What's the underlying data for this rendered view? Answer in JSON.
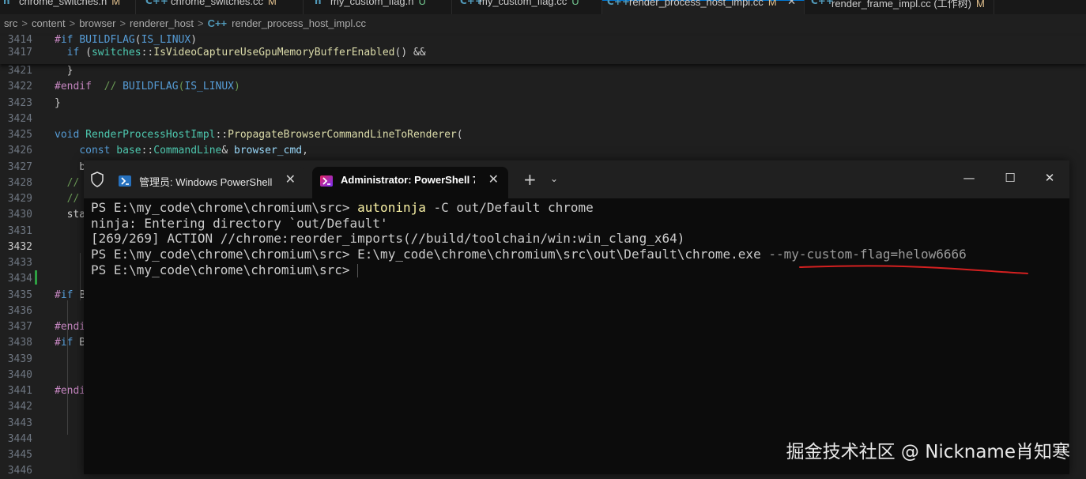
{
  "editor_tabs": [
    {
      "label": "chrome_switches.h",
      "status": "M",
      "icon": "header-file-icon",
      "icon_glyph": "h"
    },
    {
      "label": "chrome_switches.cc",
      "status": "M",
      "icon": "cpp-file-icon",
      "icon_glyph": "C++"
    },
    {
      "label": "my_custom_flag.h",
      "status": "U",
      "icon": "header-file-icon",
      "icon_glyph": "h"
    },
    {
      "label": "my_custom_flag.cc",
      "status": "U",
      "icon": "cpp-file-icon",
      "icon_glyph": "C++"
    },
    {
      "label": "render_process_host_impl.cc",
      "status": "M",
      "icon": "cpp-file-icon",
      "icon_glyph": "C++",
      "active": true,
      "close": "✕"
    },
    {
      "label": "render_frame_impl.cc (工作树)",
      "status": "M",
      "icon": "cpp-file-icon",
      "icon_glyph": "C++"
    }
  ],
  "breadcrumb": {
    "parts": [
      "src",
      "content",
      "browser",
      "renderer_host"
    ],
    "file": "render_process_host_impl.cc",
    "separator": ">",
    "file_icon": "C++"
  },
  "code_lines": [
    {
      "n": "3414",
      "text": "#if BUILDFLAG(IS_LINUX)"
    },
    {
      "n": "3417",
      "text": "  if (switches::IsVideoCaptureUseGpuMemoryBufferEnabled() &&"
    },
    {
      "n": "3421",
      "text": "  }"
    },
    {
      "n": "3422",
      "text": "#endif  // BUILDFLAG(IS_LINUX)"
    },
    {
      "n": "3423",
      "text": "}"
    },
    {
      "n": "3424",
      "text": ""
    },
    {
      "n": "3425",
      "text": "void RenderProcessHostImpl::PropagateBrowserCommandLineToRenderer("
    },
    {
      "n": "3426",
      "text": "    const base::CommandLine& browser_cmd,"
    },
    {
      "n": "3427",
      "text": "    b"
    },
    {
      "n": "3428",
      "text": "  //"
    },
    {
      "n": "3429",
      "text": "  //"
    },
    {
      "n": "3430",
      "text": "  sta"
    },
    {
      "n": "3431",
      "text": ""
    },
    {
      "n": "3432",
      "text": ""
    },
    {
      "n": "3433",
      "text": ""
    },
    {
      "n": "3434",
      "text": ""
    },
    {
      "n": "3435",
      "text": "#if B"
    },
    {
      "n": "3436",
      "text": ""
    },
    {
      "n": "3437",
      "text": "#endi"
    },
    {
      "n": "3438",
      "text": "#if B"
    },
    {
      "n": "3439",
      "text": ""
    },
    {
      "n": "3440",
      "text": ""
    },
    {
      "n": "3441",
      "text": "#endi"
    },
    {
      "n": "3442",
      "text": ""
    },
    {
      "n": "3443",
      "text": ""
    },
    {
      "n": "3444",
      "text": ""
    },
    {
      "n": "3445",
      "text": ""
    },
    {
      "n": "3446",
      "text": ""
    }
  ],
  "current_line": "3432",
  "terminal": {
    "tabs": [
      {
        "title": "管理员: Windows PowerShell",
        "close": "✕"
      },
      {
        "title": "Administrator: PowerShell 7 Pr",
        "close": "✕",
        "active": true
      }
    ],
    "new_tab": "+",
    "dropdown": "⌄",
    "window_buttons": {
      "minimize": "—",
      "maximize": "☐",
      "close": "✕"
    },
    "lines": [
      {
        "prompt": "PS E:\\my_code\\chrome\\chromium\\src> ",
        "cmd": "autoninja",
        "args": " -C out/Default chrome"
      },
      {
        "text": "ninja: Entering directory `out/Default'"
      },
      {
        "text": "[269/269] ACTION //chrome:reorder_imports(//build/toolchain/win:win_clang_x64)"
      },
      {
        "prompt": "PS E:\\my_code\\chrome\\chromium\\src> ",
        "cmd": "E:\\my_code\\chrome\\chromium\\src\\out\\Default\\chrome.exe",
        "args": " --my-custom-flag=helow6666"
      },
      {
        "prompt": "PS E:\\my_code\\chrome\\chromium\\src> ",
        "cmd": "",
        "args": ""
      }
    ]
  },
  "watermark": "掘金技术社区 @ Nickname肖知寒",
  "colors": {
    "accent": "#0078d4",
    "annotation": "#d42020",
    "added_line": "#2ea043"
  }
}
